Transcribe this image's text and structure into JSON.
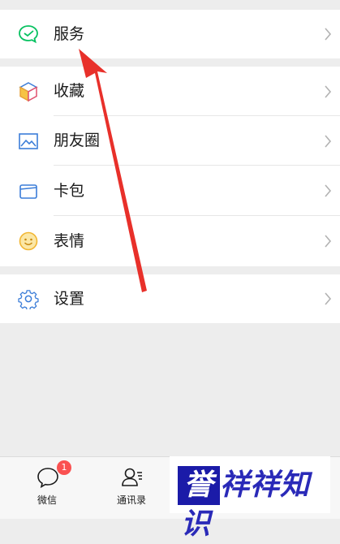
{
  "menu": {
    "services": {
      "label": "服务",
      "icon": "services-icon"
    },
    "favorites": {
      "label": "收藏",
      "icon": "cube-icon"
    },
    "moments": {
      "label": "朋友圈",
      "icon": "image-icon"
    },
    "cards": {
      "label": "卡包",
      "icon": "card-icon"
    },
    "stickers": {
      "label": "表情",
      "icon": "smile-icon"
    },
    "settings": {
      "label": "设置",
      "icon": "gear-icon"
    }
  },
  "tabbar": {
    "chats": {
      "label": "微信",
      "badge": "1"
    },
    "contacts": {
      "label": "通讯录"
    }
  },
  "watermark": {
    "text": "誉祥祥知识"
  },
  "colors": {
    "accent_green": "#07c160",
    "arrow_red": "#e8302a",
    "badge_red": "#fa5151"
  }
}
